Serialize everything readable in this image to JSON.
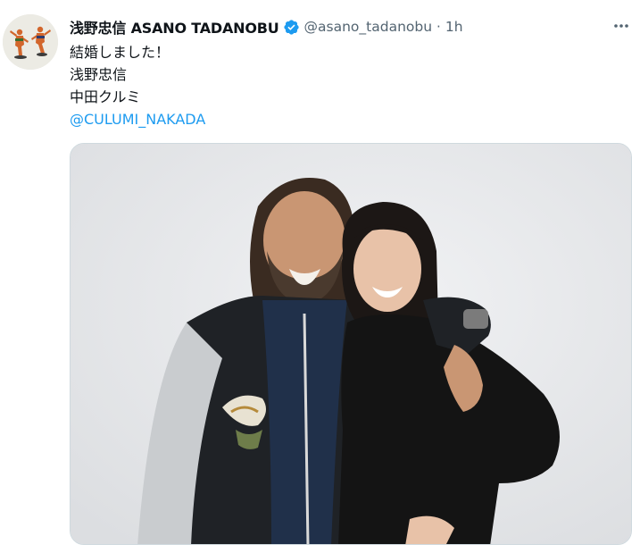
{
  "tweet": {
    "display_name": "浅野忠信 ASANO TADANOBU",
    "handle": "@asano_tadanobu",
    "separator": "·",
    "time": "1h",
    "lines": [
      "結婚しました！",
      "浅野忠信",
      "中田クルミ"
    ],
    "mention": "@CULUMI_NAKADA",
    "icons": {
      "verified": "verified-badge-icon",
      "more": "more-options-icon"
    }
  },
  "colors": {
    "accent": "#1d9bf0",
    "secondary_text": "#536471",
    "primary_text": "#0f1419",
    "border": "#cfd9de"
  }
}
